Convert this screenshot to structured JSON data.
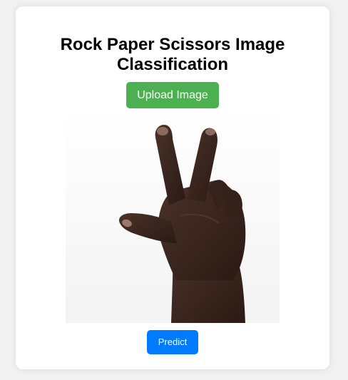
{
  "page": {
    "title": "Rock Paper Scissors Image Classification"
  },
  "upload": {
    "label": "Upload Image",
    "color": "#4caf50"
  },
  "preview": {
    "subject": "hand-scissors-gesture"
  },
  "predict": {
    "label": "Predict",
    "color": "#007bff"
  }
}
